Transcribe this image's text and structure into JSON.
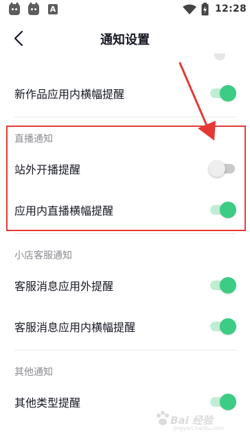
{
  "status_bar": {
    "time": "12:28",
    "left_icons": [
      "cat-app-icon",
      "cat-app-icon",
      "text-a-icon"
    ],
    "a_label": "A",
    "right_icons": [
      "wifi-icon",
      "battery-charging-icon"
    ]
  },
  "nav": {
    "title": "通知设置",
    "back_icon": "chevron-left-icon"
  },
  "sections": {
    "top": {
      "rows": [
        {
          "label": "新作品应用内横幅提醒",
          "toggle_on": true
        }
      ]
    },
    "live": {
      "title": "直播通知",
      "rows": [
        {
          "label": "站外开播提醒",
          "toggle_on": false
        },
        {
          "label": "应用内直播横幅提醒",
          "toggle_on": true
        }
      ]
    },
    "shop": {
      "title": "小店客服通知",
      "rows": [
        {
          "label": "客服消息应用外提醒",
          "toggle_on": true
        },
        {
          "label": "客服消息应用内横幅提醒",
          "toggle_on": true
        }
      ]
    },
    "other": {
      "title": "其他通知",
      "rows": [
        {
          "label": "其他类型提醒",
          "toggle_on": true
        }
      ]
    }
  },
  "annotation": {
    "color": "#e53935"
  },
  "colors": {
    "toggle_on": "#3dcc84",
    "toggle_on_track": "#c2ecd4",
    "toggle_off": "#eeeeee",
    "section_title": "#8a8b91",
    "text": "#161823"
  },
  "watermark": {
    "text": "Bai 经验",
    "sub": "jingyan.baidu.com"
  }
}
